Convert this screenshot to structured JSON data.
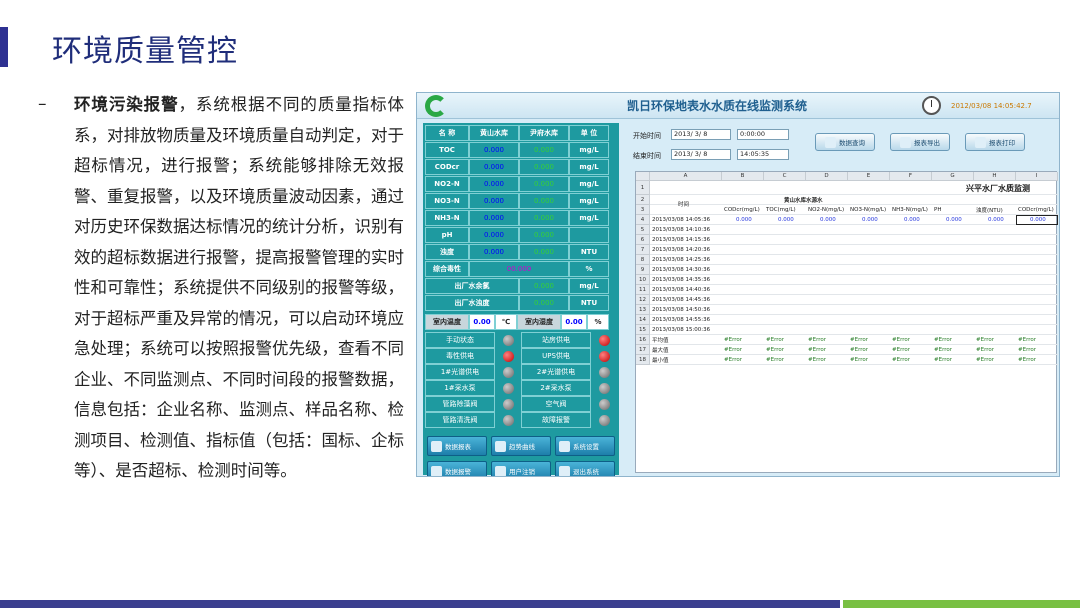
{
  "slide": {
    "title": "环境质量管控",
    "bullet": "–",
    "heading": "环境污染报警",
    "body": "，系统根据不同的质量指标体系，对排放物质量及环境质量自动判定，对于超标情况，进行报警；系统能够排除无效报警、重复报警，以及环境质量波动因素，通过对历史环保数据达标情况的统计分析，识别有效的超标数据进行报警，提高报警管理的实时性和可靠性；系统提供不同级别的报警等级，对于超标严重及异常的情况，可以启动环境应急处理；系统可以按照报警优先级，查看不同企业、不同监测点、不同时间段的报警数据，信息包括：企业名称、监测点、样品名称、检测项目、检测值、指标值（包括：国标、企标等）、是否超标、检测时间等。"
  },
  "app": {
    "title": "凯日环保地表水水质在线监测系统",
    "datetime": "2012/03/08 14:05:42.7",
    "table_headers": [
      "名 称",
      "黄山水库",
      "尹府水库",
      "单 位"
    ],
    "table_rows": [
      {
        "name": "TOC",
        "v1": "0.000",
        "v2": "0.000",
        "unit": "mg/L"
      },
      {
        "name": "CODcr",
        "v1": "0.000",
        "v2": "0.000",
        "unit": "mg/L"
      },
      {
        "name": "NO2-N",
        "v1": "0.000",
        "v2": "0.000",
        "unit": "mg/L"
      },
      {
        "name": "NO3-N",
        "v1": "0.000",
        "v2": "0.000",
        "unit": "mg/L"
      },
      {
        "name": "NH3-N",
        "v1": "0.000",
        "v2": "0.000",
        "unit": "mg/L"
      },
      {
        "name": "pH",
        "v1": "0.000",
        "v2": "0.000",
        "unit": ""
      },
      {
        "name": "浊度",
        "v1": "0.000",
        "v2": "0.000",
        "unit": "NTU"
      }
    ],
    "toxicity": {
      "label": "综合毒性",
      "value": "00.000",
      "unit": "%"
    },
    "outlet": [
      {
        "label": "出厂水余氯",
        "value": "0.000",
        "unit": "mg/L"
      },
      {
        "label": "出厂水浊度",
        "value": "0.000",
        "unit": "NTU"
      }
    ],
    "room": {
      "temp_label": "室内温度",
      "temp_value": "0.00",
      "temp_unit": "℃",
      "hum_label": "室内湿度",
      "hum_value": "0.00",
      "hum_unit": "%"
    },
    "status": [
      {
        "l1": "手动状态",
        "l2": "站房供电"
      },
      {
        "l1": "毒性供电",
        "l2": "UPS供电"
      },
      {
        "l1": "1#光谱供电",
        "l2": "2#光谱供电"
      },
      {
        "l1": "1#采水泵",
        "l2": "2#采水泵"
      },
      {
        "l1": "管路除藻阀",
        "l2": "空气阀"
      },
      {
        "l1": "管路清洗阀",
        "l2": "故障报警"
      }
    ],
    "buttons": [
      [
        "数据报表",
        "趋势曲线",
        "系统设置"
      ],
      [
        "数据报警",
        "用户注销",
        "退出系统"
      ]
    ],
    "query": {
      "start_label": "开始时间",
      "start_date": "2013/ 3/ 8",
      "start_time": "0:00:00",
      "end_label": "结束时间",
      "end_date": "2013/ 3/ 8",
      "end_time": "14:05:35",
      "btn_query": "数据查询",
      "btn_export": "报表导出",
      "btn_print": "报表打印"
    },
    "sheet": {
      "columns": [
        "A",
        "B",
        "C",
        "D",
        "E",
        "F",
        "G",
        "H",
        "I"
      ],
      "title": "兴平水厂水质监测",
      "subtitle": "黄山水库水源水",
      "time_label": "时间",
      "headers": [
        "CODcr(mg/L)",
        "TOC(mg/L)",
        "NO2-N(mg/L)",
        "NO3-N(mg/L)",
        "NH3-N(mg/L)",
        "PH",
        "浊度(NTU)",
        "CODcr(mg/L)"
      ],
      "times": [
        "2013/03/08 14:05:36",
        "2013/03/08 14:10:36",
        "2013/03/08 14:15:36",
        "2013/03/08 14:20:36",
        "2013/03/08 14:25:36",
        "2013/03/08 14:30:36",
        "2013/03/08 14:35:36",
        "2013/03/08 14:40:36",
        "2013/03/08 14:45:36",
        "2013/03/08 14:50:36",
        "2013/03/08 14:55:36",
        "2013/03/08 15:00:36"
      ],
      "first_row_value": "0.000",
      "stats": [
        "平均值",
        "最大值",
        "最小值"
      ],
      "error": "#Error"
    }
  }
}
